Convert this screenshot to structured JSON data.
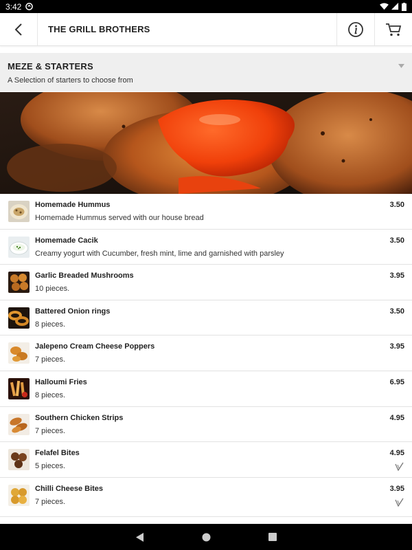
{
  "status": {
    "time": "3:42"
  },
  "header": {
    "title": "THE GRILL BROTHERS"
  },
  "section": {
    "name": "MEZE & STARTERS",
    "description": "A Selection of starters to choose from"
  },
  "items": [
    {
      "name": "Homemade Hummus",
      "description": "Homemade Hummus served with our house bread",
      "price": "3.50"
    },
    {
      "name": "Homemade Cacik",
      "description": "Creamy yogurt with Cucumber, fresh mint, lime and garnished with parsley",
      "price": "3.50"
    },
    {
      "name": "Garlic Breaded Mushrooms",
      "description": "10 pieces.",
      "price": "3.95"
    },
    {
      "name": "Battered Onion rings",
      "description": "8 pieces.",
      "price": "3.50"
    },
    {
      "name": "Jalepeno Cream Cheese Poppers",
      "description": "7 pieces.",
      "price": "3.95"
    },
    {
      "name": "Halloumi Fries",
      "description": "8 pieces.",
      "price": "6.95"
    },
    {
      "name": "Southern Chicken Strips",
      "description": "7 pieces.",
      "price": "4.95"
    },
    {
      "name": "Felafel Bites",
      "description": "5 pieces.",
      "price": "4.95"
    },
    {
      "name": "Chilli Cheese Bites",
      "description": "7 pieces.",
      "price": "3.95"
    }
  ]
}
